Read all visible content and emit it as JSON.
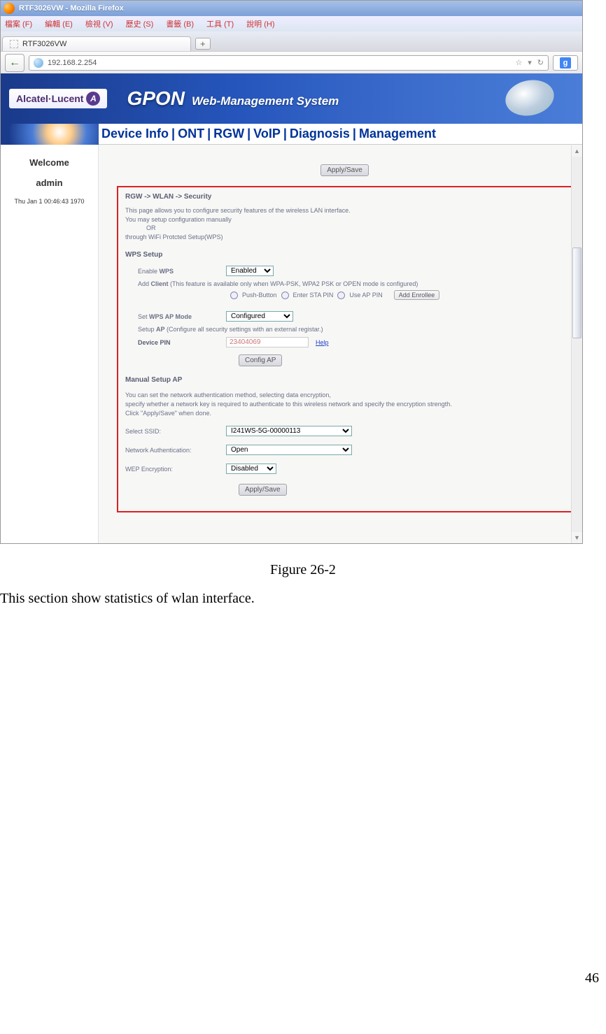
{
  "browser": {
    "window_title": "RTF3026VW - Mozilla Firefox",
    "menu": [
      "檔案 (F)",
      "編輯 (E)",
      "檢視 (V)",
      "歷史 (S)",
      "書籤 (B)",
      "工具 (T)",
      "說明 (H)"
    ],
    "tab_title": "RTF3026VW",
    "tab_add": "+",
    "back": "←",
    "url": "192.168.2.254",
    "star": "☆",
    "refresh": "↻",
    "dropdown_caret": "▾",
    "search_g": "g"
  },
  "banner": {
    "alu": "Alcatel·Lucent",
    "alu_badge": "A",
    "gpon": "GPON",
    "subtitle": "Web-Management System"
  },
  "nav": [
    "Device Info",
    "ONT",
    "RGW",
    "VoIP",
    "Diagnosis",
    "Management"
  ],
  "nav_sep": "|",
  "sidebar": {
    "welcome": "Welcome",
    "user": "admin",
    "date": "Thu Jan 1 00:46:43 1970"
  },
  "apply_save": "Apply/Save",
  "main": {
    "breadcrumb": "RGW -> WLAN -> Security",
    "intro1": "This page allows you to configure security features of the wireless LAN interface.",
    "intro2": "You may setup configuration manually",
    "intro3": "OR",
    "intro4": "through WiFi Protcted Setup(WPS)",
    "wps_setup_title": "WPS Setup",
    "enable_wps_label": "Enable WPS",
    "enable_wps_value": "Enabled",
    "add_client_note": "Add Client (This feature is available only when WPA-PSK, WPA2 PSK or OPEN mode is configured)",
    "radio_push": "Push-Button",
    "radio_sta": "Enter STA PIN",
    "radio_ap": "Use AP PIN",
    "add_enrollee_btn": "Add Enrollee",
    "wps_ap_mode_label": "Set WPS AP Mode",
    "wps_ap_mode_value": "Configured",
    "setup_ap_note": "Setup AP (Configure all security settings with an external registar.)",
    "device_pin_label": "Device PIN",
    "device_pin_value": "23404069",
    "help_link": "Help",
    "config_ap_btn": "Config AP",
    "manual_title": "Manual Setup AP",
    "manual_desc1": "You can set the network authentication method, selecting data encryption,",
    "manual_desc2": "specify whether a network key is required to authenticate to this wireless network and specify the encryption strength.",
    "manual_desc3": "Click \"Apply/Save\" when done.",
    "select_ssid_label": "Select SSID:",
    "select_ssid_value": "I241WS-5G-00000113",
    "net_auth_label": "Network Authentication:",
    "net_auth_value": "Open",
    "wep_label": "WEP Encryption:",
    "wep_value": "Disabled"
  },
  "scrollbar": {
    "up": "▲",
    "down": "▼"
  },
  "doc": {
    "caption": "Figure 26-2",
    "body": "This section show statistics of wlan interface.",
    "pagenum": "46"
  }
}
